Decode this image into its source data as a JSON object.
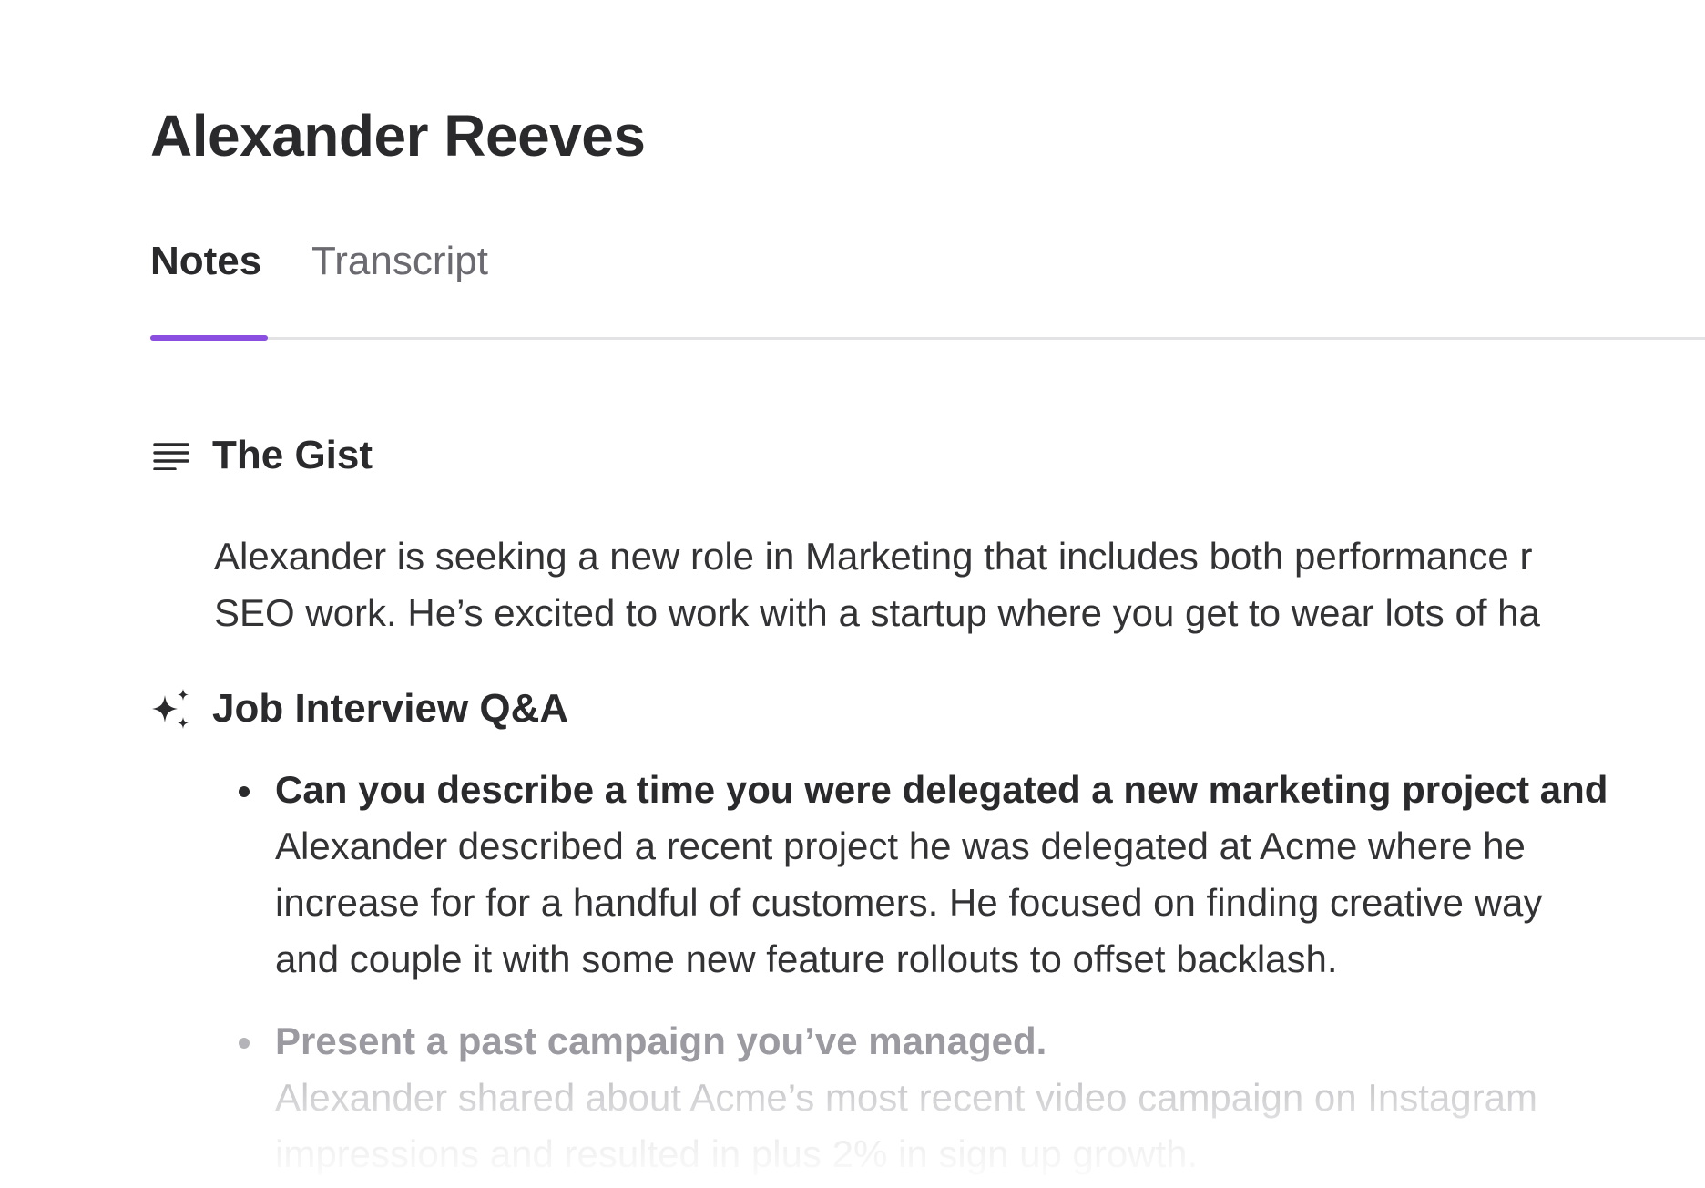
{
  "page": {
    "title": "Alexander Reeves"
  },
  "tabs": [
    {
      "label": "Notes",
      "active": true
    },
    {
      "label": "Transcript",
      "active": false
    }
  ],
  "accent_color": "#8a4ee0",
  "sections": {
    "gist": {
      "icon": "text-lines-icon",
      "heading": "The Gist",
      "lines": [
        "Alexander is seeking a new role in Marketing that includes both performance r",
        "SEO work. He’s excited to work with a startup where you get to wear lots of ha"
      ]
    },
    "qa": {
      "icon": "sparkles-icon",
      "heading": "Job Interview Q&A",
      "items": [
        {
          "question": "Can you describe a time you were delegated a new marketing project and",
          "answer_lines": [
            "Alexander described a recent project he was delegated at Acme where he",
            "increase for for a handful of customers. He focused on finding creative way",
            "and couple it with some new feature rollouts to offset backlash."
          ]
        },
        {
          "question": "Present a past campaign you’ve managed.",
          "answer_lines": [
            "Alexander shared about Acme’s most recent video campaign on Instagram",
            "impressions and resulted in plus 2% in sign up growth."
          ]
        }
      ]
    }
  }
}
